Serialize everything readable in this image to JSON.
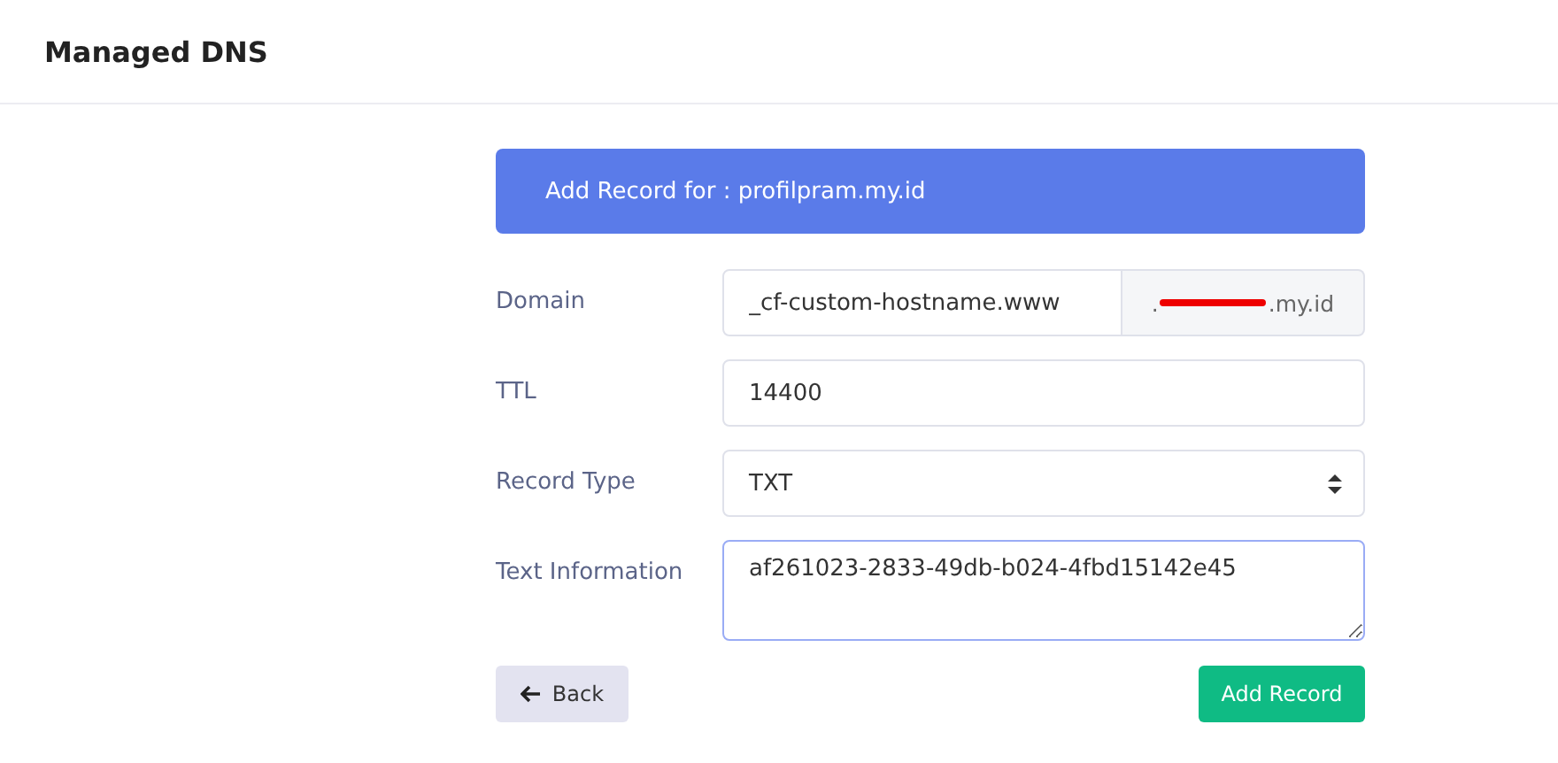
{
  "header": {
    "title": "Managed DNS"
  },
  "banner": {
    "text": "Add Record for : profilpram.my.id"
  },
  "fields": [
    {
      "kind": "input-addon",
      "label": "Domain",
      "value": "_cf-custom-hostname.www",
      "addon_start": ".",
      "addon_end": ".my.id",
      "redacted": true,
      "focused": false
    },
    {
      "kind": "input",
      "label": "TTL",
      "value": "14400",
      "focused": false
    },
    {
      "kind": "select",
      "label": "Record Type",
      "value": "TXT",
      "focused": false
    },
    {
      "kind": "textarea",
      "label": "Text Information",
      "value": "af261023-2833-49db-b024-4fbd15142e45",
      "focused": true
    }
  ],
  "buttons": {
    "back": "Back",
    "submit": "Add Record"
  }
}
